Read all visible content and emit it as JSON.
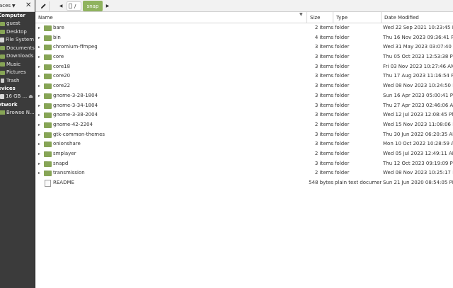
{
  "sidebar": {
    "places_label": "laces",
    "sections": {
      "computer": "Computer",
      "devices": "evices",
      "network": "etwork"
    },
    "computer_items": [
      {
        "label": "guest",
        "icon": "folder-icon"
      },
      {
        "label": "Desktop",
        "icon": "folder-icon"
      },
      {
        "label": "File System",
        "icon": "drive-icon"
      },
      {
        "label": "Documents",
        "icon": "folder-icon"
      },
      {
        "label": "Downloads",
        "icon": "folder-icon"
      },
      {
        "label": "Music",
        "icon": "folder-icon"
      },
      {
        "label": "Pictures",
        "icon": "folder-icon"
      },
      {
        "label": "Trash",
        "icon": "trash-icon"
      }
    ],
    "device_items": [
      {
        "label": "16 GB ...",
        "icon": "drive-icon"
      }
    ],
    "network_items": [
      {
        "label": "Browse N...",
        "icon": "network-icon"
      }
    ]
  },
  "toolbar": {
    "root_crumb": "/",
    "active_crumb": "snap"
  },
  "columns": {
    "name": "Name",
    "size": "Size",
    "type": "Type",
    "date": "Date Modified"
  },
  "files": [
    {
      "name": "bare",
      "size": "2 items",
      "type": "folder",
      "date": "Wed 22 Sep 2021 10:23:45 PM",
      "kind": "folder"
    },
    {
      "name": "bin",
      "size": "4 items",
      "type": "folder",
      "date": "Thu 16 Nov 2023 09:36:41 PM",
      "kind": "folder"
    },
    {
      "name": "chromium-ffmpeg",
      "size": "3 items",
      "type": "folder",
      "date": "Wed 31 May 2023 03:07:40 PM",
      "kind": "folder"
    },
    {
      "name": "core",
      "size": "3 items",
      "type": "folder",
      "date": "Thu 05 Oct 2023 12:53:38 PM",
      "kind": "folder"
    },
    {
      "name": "core18",
      "size": "3 items",
      "type": "folder",
      "date": "Fri 03 Nov 2023 10:27:46 AM",
      "kind": "folder"
    },
    {
      "name": "core20",
      "size": "3 items",
      "type": "folder",
      "date": "Thu 17 Aug 2023 11:16:54 PM",
      "kind": "folder"
    },
    {
      "name": "core22",
      "size": "3 items",
      "type": "folder",
      "date": "Wed 08 Nov 2023 10:24:50 PM",
      "kind": "folder"
    },
    {
      "name": "gnome-3-28-1804",
      "size": "3 items",
      "type": "folder",
      "date": "Sun 16 Apr 2023 05:00:41 PM",
      "kind": "folder"
    },
    {
      "name": "gnome-3-34-1804",
      "size": "3 items",
      "type": "folder",
      "date": "Thu 27 Apr 2023 02:46:06 AM",
      "kind": "folder"
    },
    {
      "name": "gnome-3-38-2004",
      "size": "3 items",
      "type": "folder",
      "date": "Wed 12 Jul 2023 12:08:45 PM",
      "kind": "folder"
    },
    {
      "name": "gnome-42-2204",
      "size": "2 items",
      "type": "folder",
      "date": "Wed 15 Nov 2023 11:08:06 PM",
      "kind": "folder"
    },
    {
      "name": "gtk-common-themes",
      "size": "3 items",
      "type": "folder",
      "date": "Thu 30 Jun 2022 06:20:35 AM",
      "kind": "folder"
    },
    {
      "name": "onionshare",
      "size": "3 items",
      "type": "folder",
      "date": "Mon 10 Oct 2022 10:28:59 AM",
      "kind": "folder"
    },
    {
      "name": "smplayer",
      "size": "2 items",
      "type": "folder",
      "date": "Wed 05 Jul 2023 12:49:11 AM",
      "kind": "folder"
    },
    {
      "name": "snapd",
      "size": "3 items",
      "type": "folder",
      "date": "Thu 12 Oct 2023 09:19:09 PM",
      "kind": "folder"
    },
    {
      "name": "transmission",
      "size": "2 items",
      "type": "folder",
      "date": "Wed 08 Nov 2023 10:25:17 PM",
      "kind": "folder"
    },
    {
      "name": "README",
      "size": "548 bytes",
      "type": "plain text document",
      "date": "Sun 21 Jun 2020 08:54:05 PM",
      "kind": "file"
    }
  ],
  "colors": {
    "accent": "#8fb35e",
    "folder": "#87a556",
    "sidebar_bg": "#3b3b3b"
  }
}
